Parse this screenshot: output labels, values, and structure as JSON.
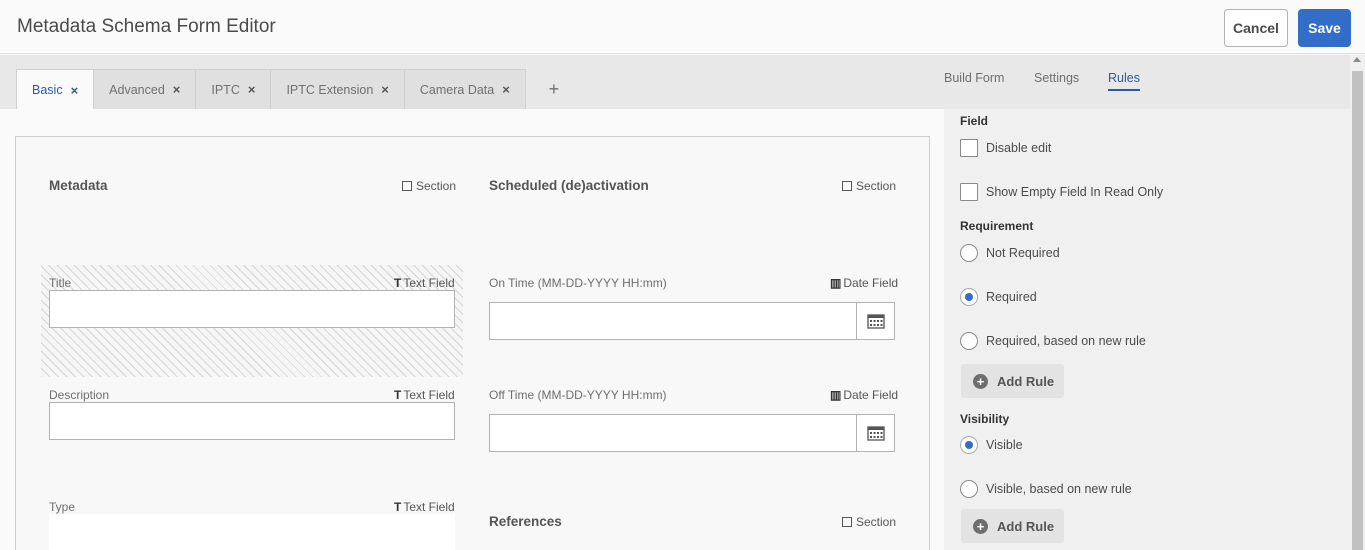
{
  "header": {
    "title": "Metadata Schema Form Editor",
    "cancel_label": "Cancel",
    "save_label": "Save"
  },
  "tabs": [
    {
      "label": "Basic",
      "active": true
    },
    {
      "label": "Advanced"
    },
    {
      "label": "IPTC"
    },
    {
      "label": "IPTC Extension"
    },
    {
      "label": "Camera Data"
    }
  ],
  "tab_close": "×",
  "tab_add": "+",
  "form": {
    "section_tag": "Section",
    "metadata": {
      "title": "Metadata",
      "fields": [
        {
          "label": "Title",
          "type": "Text Field"
        },
        {
          "label": "Description",
          "type": "Text Field"
        },
        {
          "label": "Type",
          "type": "Text Field"
        }
      ]
    },
    "scheduled": {
      "title": "Scheduled (de)activation",
      "fields": [
        {
          "label": "On Time (MM-DD-YYYY HH:mm)",
          "type": "Date Field"
        },
        {
          "label": "Off Time (MM-DD-YYYY HH:mm)",
          "type": "Date Field"
        }
      ]
    },
    "references": {
      "title": "References"
    }
  },
  "right_panel": {
    "tabs": [
      "Build Form",
      "Settings",
      "Rules"
    ],
    "active_tab": "Rules",
    "field_heading": "Field",
    "disable_edit": "Disable edit",
    "show_empty": "Show Empty Field In Read Only",
    "requirement_heading": "Requirement",
    "requirement_options": [
      "Not Required",
      "Required",
      "Required, based on new rule"
    ],
    "requirement_selected": "Required",
    "add_rule_label": "Add Rule",
    "visibility_heading": "Visibility",
    "visibility_options": [
      "Visible",
      "Visible, based on new rule"
    ],
    "visibility_selected": "Visible"
  }
}
